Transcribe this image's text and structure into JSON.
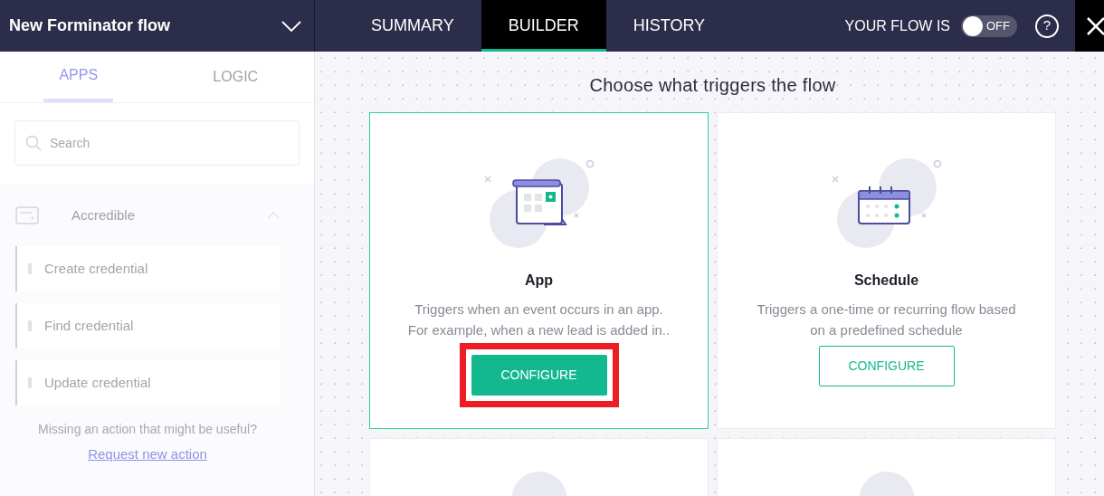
{
  "header": {
    "flow_name": "New Forminator flow",
    "tabs": [
      {
        "label": "SUMMARY",
        "selected": false
      },
      {
        "label": "BUILDER",
        "selected": true
      },
      {
        "label": "HISTORY",
        "selected": false
      }
    ],
    "flow_status_label": "YOUR FLOW IS",
    "toggle": {
      "on": false,
      "label": "OFF"
    },
    "help": "?"
  },
  "sidebar": {
    "tabs": [
      {
        "label": "APPS",
        "selected": true
      },
      {
        "label": "LOGIC",
        "selected": false
      }
    ],
    "search": {
      "placeholder": "Search"
    },
    "app_group": {
      "name": "Accredible",
      "expanded": true,
      "actions": [
        "Create credential",
        "Find credential",
        "Update credential"
      ]
    },
    "missing_text": "Missing an action that might be useful?",
    "request_link": "Request new action"
  },
  "main": {
    "title": "Choose what triggers the flow",
    "cards": [
      {
        "kind": "app",
        "title": "App",
        "description": "Triggers when an event occurs in an app.\nFor example, when a new lead is added in..",
        "button": "CONFIGURE",
        "selected": true,
        "highlighted": true
      },
      {
        "kind": "schedule",
        "title": "Schedule",
        "description": "Triggers a one-time or recurring flow based\non a predefined schedule",
        "button": "CONFIGURE",
        "selected": false,
        "highlighted": false
      },
      {
        "kind": "partial",
        "selected": false
      },
      {
        "kind": "partial",
        "selected": false
      }
    ]
  }
}
